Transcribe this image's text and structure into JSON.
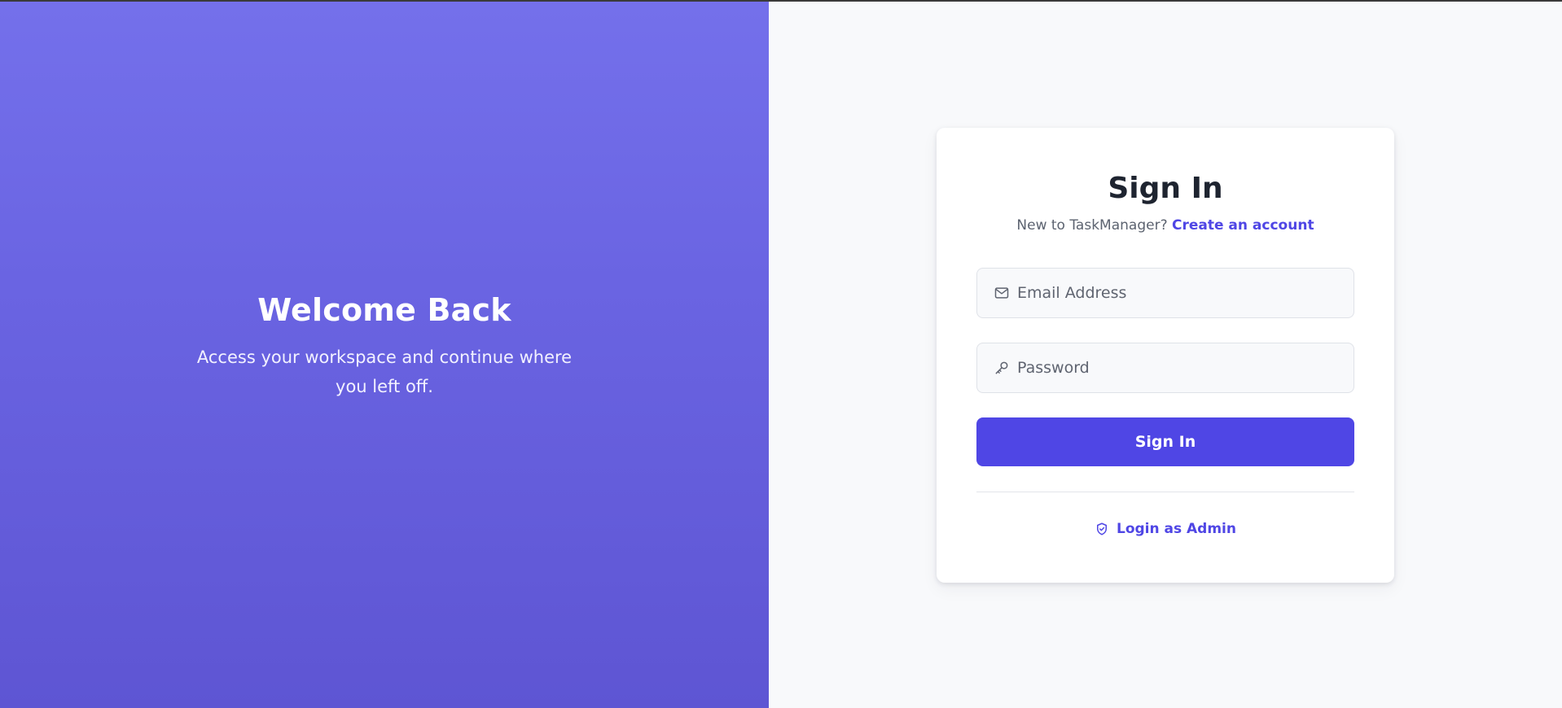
{
  "hero": {
    "title": "Welcome Back",
    "subtitle": "Access your workspace and continue where you left off."
  },
  "signin_card": {
    "title": "Sign In",
    "prompt_text": "New to TaskManager?",
    "create_account_link": "Create an account",
    "email": {
      "placeholder": "Email Address",
      "value": "",
      "icon": "mail-icon"
    },
    "password": {
      "placeholder": "Password",
      "value": "",
      "icon": "key-icon"
    },
    "submit_label": "Sign In",
    "admin_link_label": "Login as Admin",
    "admin_icon": "shield-icon"
  },
  "colors": {
    "accent": "#4f46e5",
    "hero_gradient_top": "#7470eb",
    "hero_gradient_bottom": "#5e55d3",
    "page_bg": "#f8f9fb"
  }
}
